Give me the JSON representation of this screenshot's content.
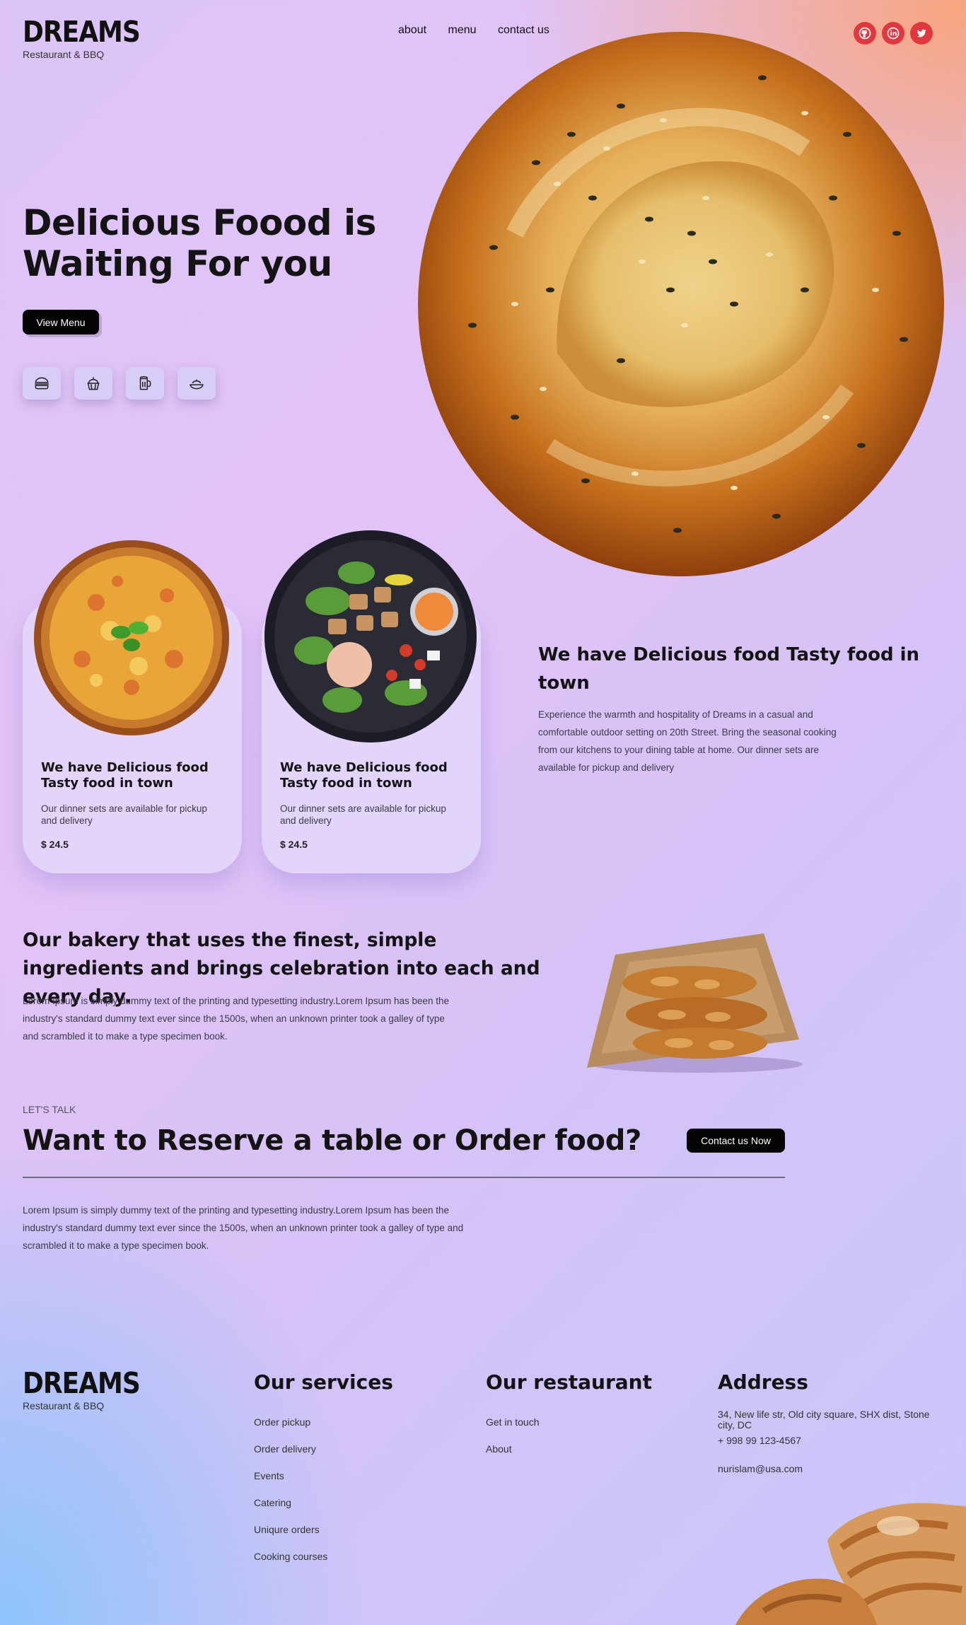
{
  "brand": {
    "name": "DREAMS",
    "tagline": "Restaurant & BBQ"
  },
  "nav": {
    "items": [
      "about",
      "menu",
      "contact us"
    ]
  },
  "social": [
    "github-icon",
    "linkedin-icon",
    "twitter-icon"
  ],
  "hero": {
    "title_line1": "Delicious Foood is",
    "title_line2": "Waiting For you",
    "cta": "View Menu",
    "categories": [
      "burger-icon",
      "cupcake-icon",
      "beer-icon",
      "dish-icon"
    ]
  },
  "cards": [
    {
      "title": "We have Delicious food Tasty food in town",
      "desc": "Our dinner sets are available for pickup and delivery",
      "price": "$ 24.5"
    },
    {
      "title": "We have Delicious food Tasty food in town",
      "desc": "Our dinner sets are available for pickup and delivery",
      "price": "$ 24.5"
    }
  ],
  "about": {
    "title": "We have Delicious food Tasty food in town",
    "text": "Experience the warmth and hospitality of Dreams in a casual and comfortable outdoor setting on 20th Street. Bring the seasonal cooking from our kitchens to your dining table at home. Our dinner sets are available for pickup and delivery"
  },
  "bakery": {
    "title": "Our bakery that uses the finest, simple ingredients and brings celebration into each and every day.",
    "text": "Lorem Ipsum is simply dummy text of the printing and typesetting industry.Lorem Ipsum has been the industry's standard dummy text ever since the 1500s, when an unknown printer took a galley of type and scrambled it to make a type specimen book."
  },
  "reserve": {
    "eyebrow": "LET'S TALK",
    "title": "Want to Reserve a table or Order food?",
    "cta": "Contact us Now",
    "text": "Lorem Ipsum is simply dummy text of the printing and typesetting industry.Lorem Ipsum has been the industry's standard dummy text ever since the 1500s, when an unknown printer took a galley of type and scrambled it to make a type specimen book."
  },
  "footer": {
    "services": {
      "title": "Our services",
      "items": [
        "Order pickup",
        "Order delivery",
        "Events",
        "Catering",
        "Uniqure orders",
        "Cooking courses"
      ]
    },
    "restaurant": {
      "title": "Our restaurant",
      "items": [
        "Get in touch",
        "About"
      ]
    },
    "address": {
      "title": "Address",
      "street": "34, New life str, Old city square, SHX dist, Stone city, DC",
      "phone": "+ 998 99 123-4567",
      "email": "nurislam@usa.com"
    }
  },
  "colors": {
    "social": "#e0383e",
    "button": "#050505",
    "bread": "#c5701e"
  }
}
